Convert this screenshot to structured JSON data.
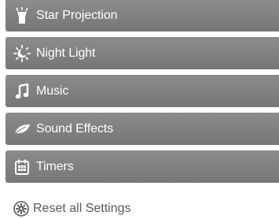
{
  "menu": {
    "items": [
      {
        "label": "Star Projection",
        "icon": "projector-icon"
      },
      {
        "label": "Night Light",
        "icon": "sun-moon-icon"
      },
      {
        "label": "Music",
        "icon": "music-note-icon"
      },
      {
        "label": "Sound Effects",
        "icon": "leaf-icon"
      },
      {
        "label": "Timers",
        "icon": "calendar-icon"
      }
    ]
  },
  "reset": {
    "label": "Reset all Settings",
    "icon": "reset-gear-icon"
  },
  "colors": {
    "menu_bg": "#818181",
    "menu_text": "#ffffff",
    "reset_text": "#5a5a5a",
    "page_bg": "#ffffff"
  }
}
